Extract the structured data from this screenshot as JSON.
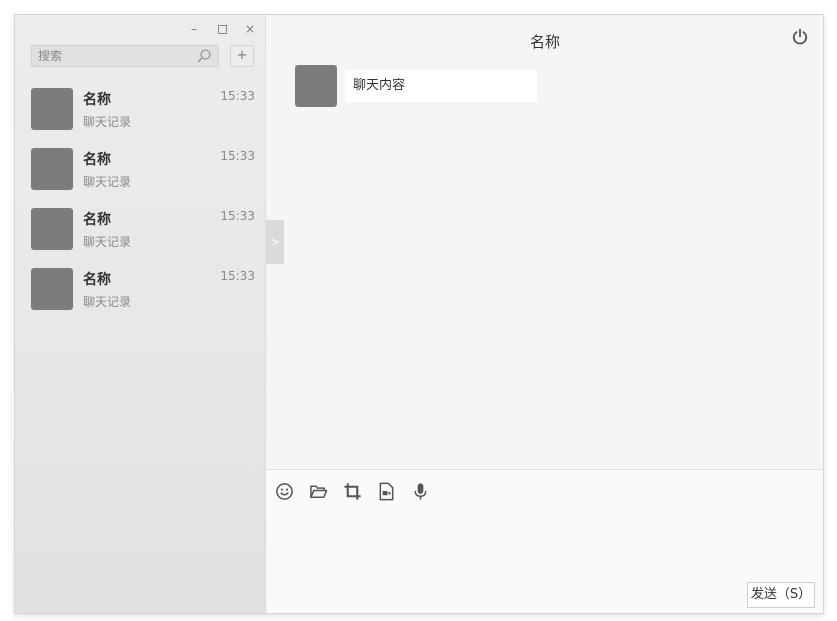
{
  "window_controls": {
    "minimize": "–",
    "close": "×"
  },
  "search": {
    "placeholder": "搜索"
  },
  "add_label": "+",
  "contacts": [
    {
      "name": "名称",
      "preview": "聊天记录",
      "time": "15:33"
    },
    {
      "name": "名称",
      "preview": "聊天记录",
      "time": "15:33"
    },
    {
      "name": "名称",
      "preview": "聊天记录",
      "time": "15:33"
    },
    {
      "name": "名称",
      "preview": "聊天记录",
      "time": "15:33"
    }
  ],
  "toggle_label": ">",
  "chat": {
    "title": "名称",
    "messages": [
      {
        "text": "聊天内容"
      }
    ]
  },
  "toolbar_icons": [
    "emoji-icon",
    "folder-icon",
    "crop-icon",
    "video-file-icon",
    "microphone-icon"
  ],
  "send_label": "发送（S）",
  "colors": {
    "avatar": "#7c7c7c",
    "sidebar_bg": "#e9e9e9",
    "chat_bg": "#f5f5f5",
    "compose_bg": "#fafafa"
  }
}
